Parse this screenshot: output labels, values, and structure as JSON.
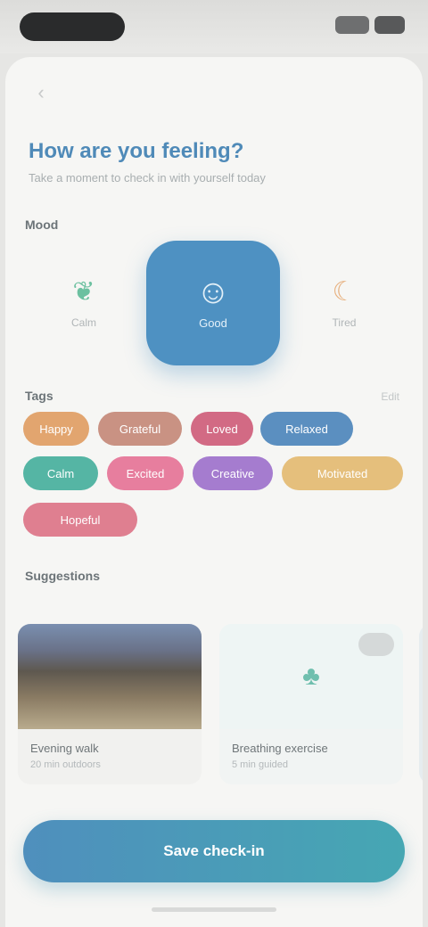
{
  "screen": {
    "title": "How are you feeling?",
    "subtitle": "Take a moment to check in with yourself today",
    "back_icon": "chevron-left-icon"
  },
  "mood": {
    "section_label": "Mood",
    "options": [
      {
        "label": "Calm",
        "icon": "leaf-icon"
      },
      {
        "label": "Good",
        "icon": "smile-icon",
        "selected": true
      },
      {
        "label": "Tired",
        "icon": "moon-icon"
      }
    ]
  },
  "feelings": {
    "section_label": "Tags",
    "link_label": "Edit",
    "tags": [
      {
        "label": "Happy",
        "color": "#e2a56f"
      },
      {
        "label": "Grateful",
        "color": "#c99283"
      },
      {
        "label": "Loved",
        "color": "#d26a84"
      },
      {
        "label": "Relaxed",
        "color": "#5b8fc0"
      },
      {
        "label": "Calm",
        "color": "#55b5a4"
      },
      {
        "label": "Excited",
        "color": "#e77e9e"
      },
      {
        "label": "Creative",
        "color": "#a57ccf"
      },
      {
        "label": "Motivated",
        "color": "#e5bf7c"
      },
      {
        "label": "Hopeful",
        "color": "#df7f90"
      }
    ]
  },
  "activities": {
    "section_label": "Suggestions",
    "cards": [
      {
        "title": "Evening walk",
        "subtitle": "20 min outdoors"
      },
      {
        "title": "Breathing exercise",
        "subtitle": "5 min guided"
      }
    ]
  },
  "cta": {
    "label": "Save check-in"
  },
  "colors": {
    "accent": "#4e91c2",
    "accent_end": "#46a7b3",
    "background": "#f6f6f4"
  }
}
